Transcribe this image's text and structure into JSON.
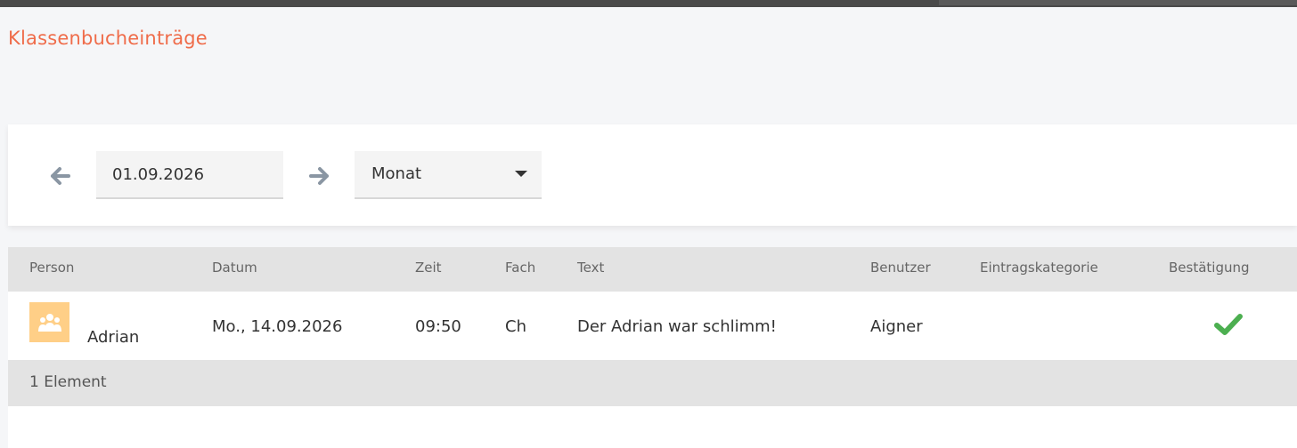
{
  "page": {
    "title": "Klassenbucheinträge",
    "title_color": "#ef6c4a"
  },
  "filter": {
    "prev_icon": "arrow-left-icon",
    "date_value": "01.09.2026",
    "next_icon": "arrow-right-icon",
    "period_selected": "Monat"
  },
  "table": {
    "headers": {
      "person": "Person",
      "datum": "Datum",
      "zeit": "Zeit",
      "fach": "Fach",
      "text": "Text",
      "benutzer": "Benutzer",
      "eintragskategorie": "Eintragskategorie",
      "bestaetigung": "Bestätigung"
    },
    "rows": [
      {
        "avatar_icon": "group-icon",
        "person": "Adrian",
        "datum": "Mo., 14.09.2026",
        "zeit": "09:50",
        "fach": "Ch",
        "text": "Der Adrian war schlimm!",
        "benutzer": "Aigner",
        "eintragskategorie": "",
        "bestaetigung_icon": "check-icon",
        "confirmed": true
      }
    ],
    "footer_count": "1 Element"
  },
  "colors": {
    "accent": "#ef6c4a",
    "arrow": "#8a96a3",
    "check": "#4caf50",
    "avatar_bg": "#ffcf87"
  }
}
